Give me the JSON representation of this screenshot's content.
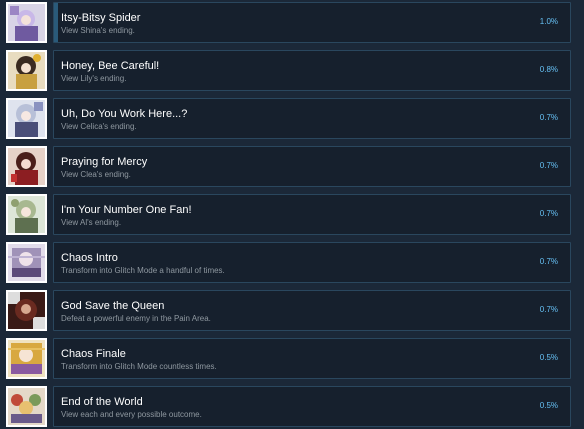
{
  "achievements": [
    {
      "title": "Itsy-Bitsy Spider",
      "description": "View Shina's ending.",
      "percent": "1.0%",
      "icon": "character-portrait-icon"
    },
    {
      "title": "Honey, Bee Careful!",
      "description": "View Lily's ending.",
      "percent": "0.8%",
      "icon": "character-portrait-icon"
    },
    {
      "title": "Uh, Do You Work Here...?",
      "description": "View Celica's ending.",
      "percent": "0.7%",
      "icon": "character-portrait-icon"
    },
    {
      "title": "Praying for Mercy",
      "description": "View Clea's ending.",
      "percent": "0.7%",
      "icon": "character-portrait-icon"
    },
    {
      "title": "I'm Your Number One Fan!",
      "description": "View Al's ending.",
      "percent": "0.7%",
      "icon": "character-portrait-icon"
    },
    {
      "title": "Chaos Intro",
      "description": "Transform into Glitch Mode a handful of times.",
      "percent": "0.7%",
      "icon": "glitch-portrait-icon"
    },
    {
      "title": "God Save the Queen",
      "description": "Defeat a powerful enemy in the Pain Area.",
      "percent": "0.7%",
      "icon": "queen-portrait-icon"
    },
    {
      "title": "Chaos Finale",
      "description": "Transform into Glitch Mode countless times.",
      "percent": "0.5%",
      "icon": "glitch-portrait-icon"
    },
    {
      "title": "End of the World",
      "description": "View each and every possible outcome.",
      "percent": "0.5%",
      "icon": "group-portrait-icon"
    }
  ],
  "colors": {
    "background": "#1b2838",
    "panel": "#16202d",
    "panel_border": "#2a475e",
    "title": "#ffffff",
    "description": "#8f98a0",
    "percent": "#66c0f4"
  }
}
